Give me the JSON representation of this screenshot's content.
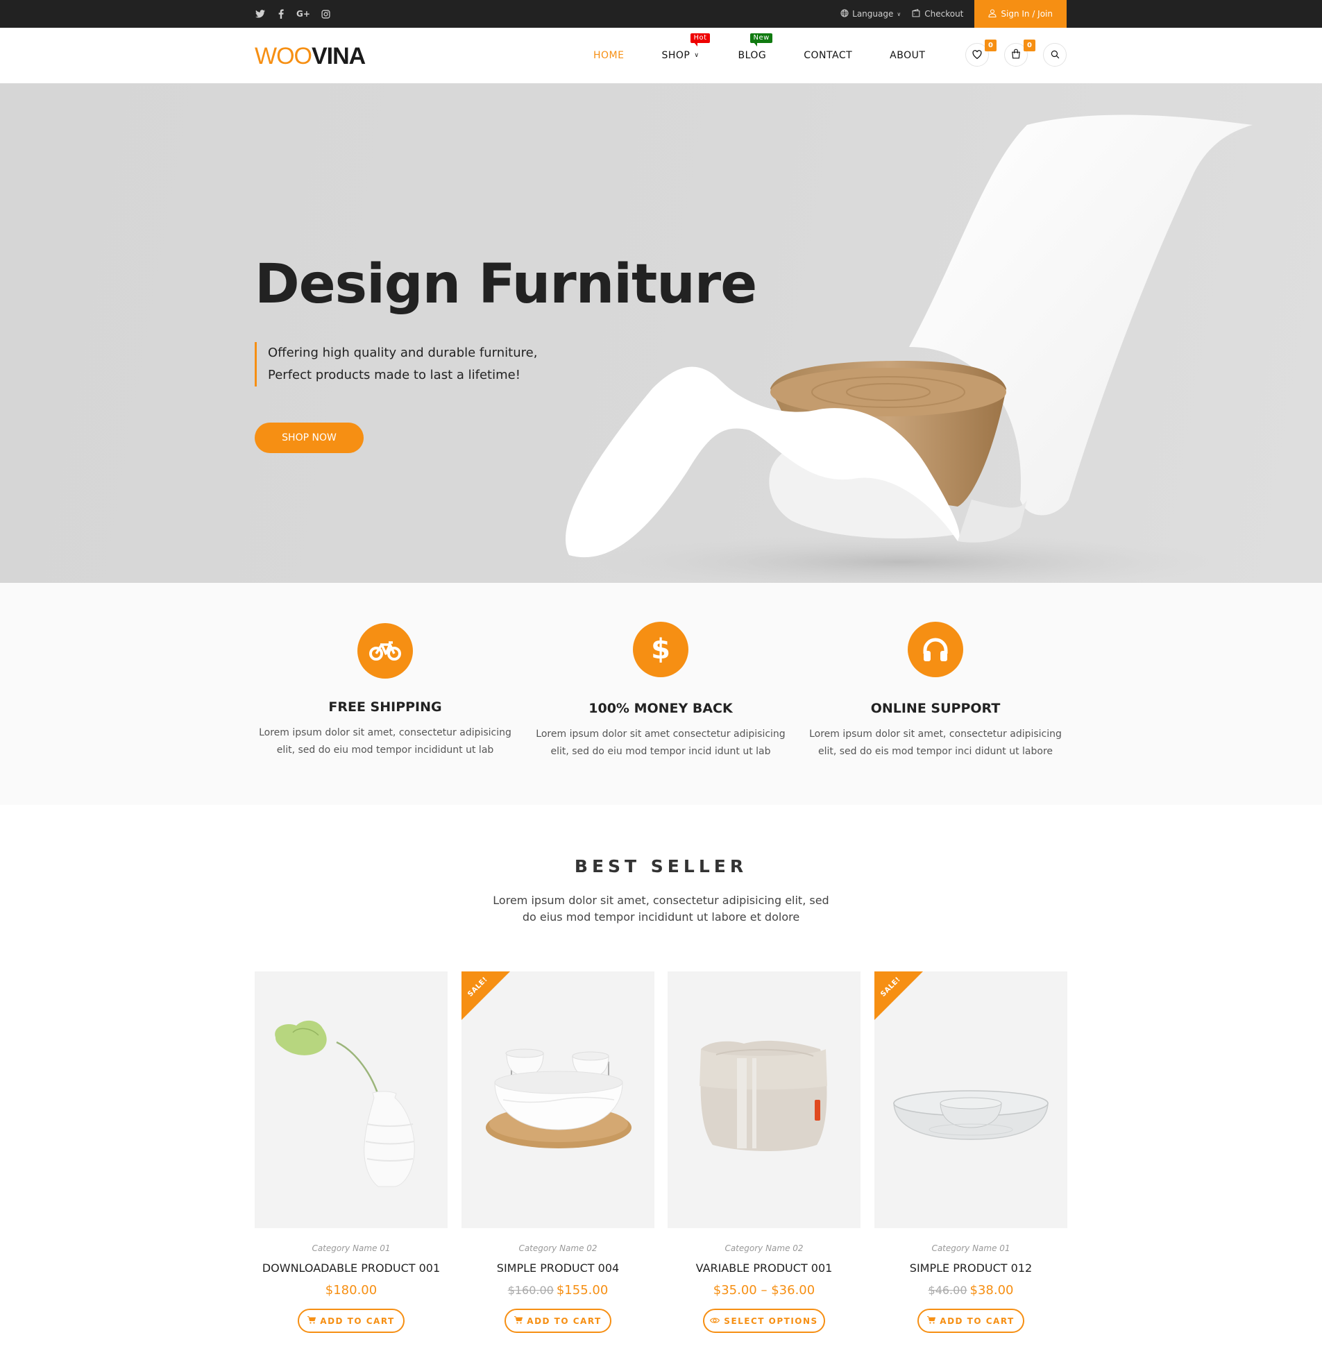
{
  "topbar": {
    "social": [
      "twitter-icon",
      "facebook-icon",
      "google-plus-icon",
      "instagram-icon"
    ],
    "language_label": "Language",
    "checkout_label": "Checkout",
    "signin_label": "Sign In / Join"
  },
  "header": {
    "logo_part1": "WOO",
    "logo_part2": "VINA",
    "nav": [
      {
        "label": "HOME",
        "active": true
      },
      {
        "label": "SHOP",
        "badge": "Hot",
        "has_dropdown": true
      },
      {
        "label": "BLOG",
        "badge": "New"
      },
      {
        "label": "CONTACT"
      },
      {
        "label": "ABOUT"
      }
    ],
    "wishlist_count": "0",
    "cart_count": "0"
  },
  "hero": {
    "title": "Design Furniture",
    "subtitle_line1": "Offering high quality and durable furniture,",
    "subtitle_line2": "Perfect products made to last a lifetime!",
    "button_label": "SHOP NOW"
  },
  "features": [
    {
      "icon": "bicycle-icon",
      "title": "FREE SHIPPING",
      "line1": "Lorem ipsum dolor sit amet, consectetur adipisicing",
      "line2": "elit, sed do eiu mod tempor incididunt ut lab"
    },
    {
      "icon": "dollar-icon",
      "title": "100% MONEY BACK",
      "line1": "Lorem ipsum dolor sit amet consectetur adipisicing",
      "line2": "elit, sed do eiu mod tempor incid idunt ut lab"
    },
    {
      "icon": "headphones-icon",
      "title": "ONLINE SUPPORT",
      "line1": "Lorem ipsum dolor sit amet, consectetur adipisicing",
      "line2": "elit, sed do eis mod tempor inci didunt ut labore"
    }
  ],
  "best_seller": {
    "title": "BEST SELLER",
    "sub_line1": "Lorem ipsum dolor sit amet, consectetur adipisicing elit, sed",
    "sub_line2": "do eius mod tempor incididunt ut labore et dolore",
    "products": [
      {
        "category": "Category Name 01",
        "name": "DOWNLOADABLE PRODUCT 001",
        "old_price": "",
        "price": "$180.00",
        "sale": false,
        "button": "ADD TO CART",
        "button_icon": "cart-icon",
        "image": "vase-with-leaf"
      },
      {
        "category": "Category Name 02",
        "name": "SIMPLE PRODUCT 004",
        "old_price": "$160.00",
        "price": "$155.00",
        "sale": true,
        "button": "ADD TO CART",
        "button_icon": "cart-icon",
        "image": "bowl-set-on-wood-tray"
      },
      {
        "category": "Category Name 02",
        "name": "VARIABLE PRODUCT 001",
        "old_price": "",
        "price": "$35.00 – $36.00",
        "sale": false,
        "button": "SELECT OPTIONS",
        "button_icon": "eye-icon",
        "image": "linen-bread-basket"
      },
      {
        "category": "Category Name 01",
        "name": "SIMPLE PRODUCT 012",
        "old_price": "$46.00",
        "price": "$38.00",
        "sale": true,
        "button": "ADD TO CART",
        "button_icon": "cart-icon",
        "image": "glass-chip-dip-bowl"
      }
    ],
    "sale_label": "SALE!"
  },
  "colors": {
    "accent": "#f68f13",
    "topbar": "#222222",
    "hot": "#ee0000",
    "new": "#107a10"
  }
}
